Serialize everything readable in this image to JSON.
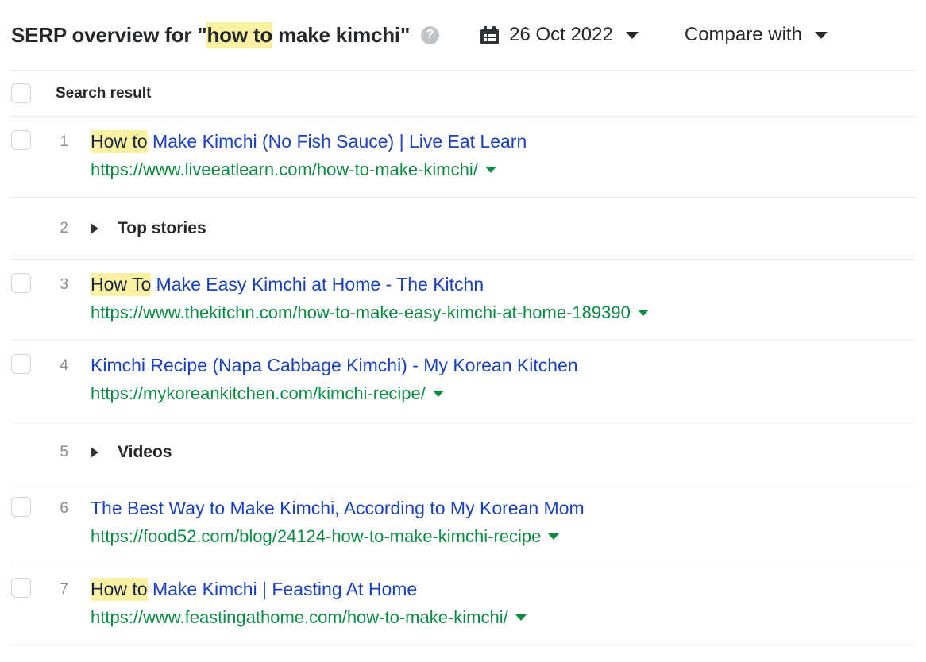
{
  "header": {
    "title_prefix": "SERP overview for \"",
    "title_highlight": "how to",
    "title_suffix": " make kimchi\"",
    "help_icon_glyph": "?",
    "help_icon_name": "help-circle-icon",
    "date_value": "26 Oct 2022",
    "date_icon_name": "calendar-icon",
    "compare_label": "Compare with",
    "caret_glyph": "▾"
  },
  "table": {
    "column_header": "Search result",
    "rows": [
      {
        "kind": "result",
        "rank": "1",
        "has_checkbox": true,
        "title_highlight": "How to",
        "title_rest": " Make Kimchi (No Fish Sauce) | Live Eat Learn",
        "url": "https://www.liveeatlearn.com/how-to-make-kimchi/"
      },
      {
        "kind": "feature",
        "rank": "2",
        "has_checkbox": false,
        "label": "Top stories"
      },
      {
        "kind": "result",
        "rank": "3",
        "has_checkbox": true,
        "title_highlight": "How To",
        "title_rest": " Make Easy Kimchi at Home - The Kitchn",
        "url": "https://www.thekitchn.com/how-to-make-easy-kimchi-at-home-189390"
      },
      {
        "kind": "result",
        "rank": "4",
        "has_checkbox": true,
        "title_highlight": "",
        "title_rest": "Kimchi Recipe (Napa Cabbage Kimchi) - My Korean Kitchen",
        "url": "https://mykoreankitchen.com/kimchi-recipe/"
      },
      {
        "kind": "feature",
        "rank": "5",
        "has_checkbox": false,
        "label": "Videos"
      },
      {
        "kind": "result",
        "rank": "6",
        "has_checkbox": true,
        "title_highlight": "",
        "title_rest": "The Best Way to Make Kimchi, According to My Korean Mom",
        "url": "https://food52.com/blog/24124-how-to-make-kimchi-recipe"
      },
      {
        "kind": "result",
        "rank": "7",
        "has_checkbox": true,
        "title_highlight": "How to",
        "title_rest": " Make Kimchi | Feasting At Home",
        "url": "https://www.feastingathome.com/how-to-make-kimchi/"
      }
    ]
  },
  "colors": {
    "title_link": "#1a41bd",
    "url_green": "#0c8a43",
    "highlight_yellow": "#f9f0a1",
    "text_dark": "#25282a",
    "rank_gray": "#868b8f",
    "divider": "#e7e8ec"
  }
}
